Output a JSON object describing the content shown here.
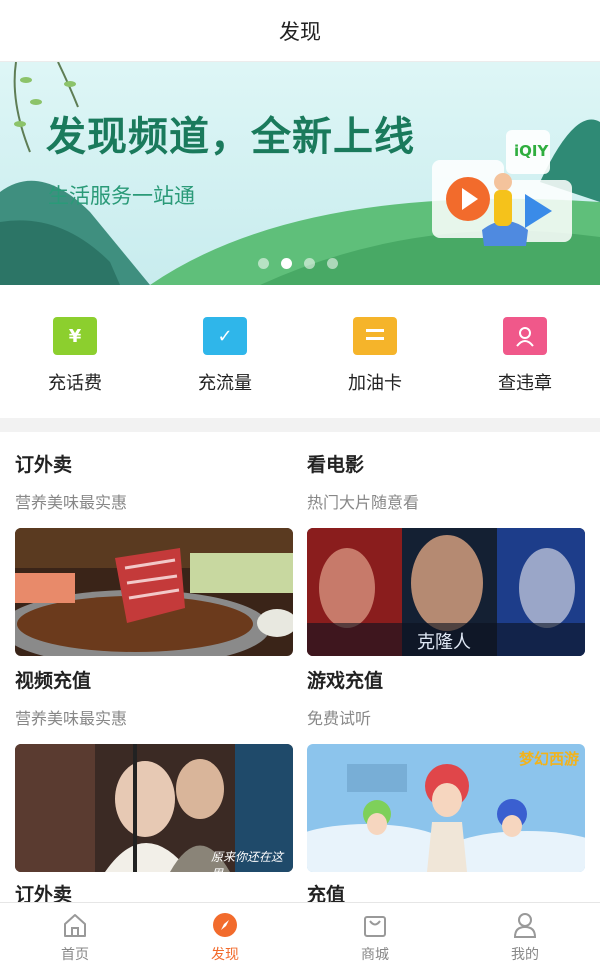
{
  "header": {
    "title": "发现"
  },
  "banner": {
    "title": "发现频道，全新上线",
    "subtitle": "生活服务一站通",
    "logo_text": "iQIY",
    "dots": 4,
    "active_dot": 1
  },
  "services": [
    {
      "label": "充话费",
      "icon": "yuan-card-icon",
      "symbol": "¥",
      "color": "#8ccf2e"
    },
    {
      "label": "充流量",
      "icon": "calendar-check-icon",
      "symbol": "✓",
      "color": "#2fb6ea"
    },
    {
      "label": "加油卡",
      "icon": "fuel-card-icon",
      "symbol": "",
      "color": "#f5b42a"
    },
    {
      "label": "查违章",
      "icon": "person-card-icon",
      "symbol": "",
      "color": "#f0588a"
    }
  ],
  "cards": [
    {
      "title": "订外卖",
      "subtitle": "营养美味最实惠"
    },
    {
      "title": "看电影",
      "subtitle": "热门大片随意看",
      "image_text": "克隆人"
    },
    {
      "title": "视频充值",
      "subtitle": "营养美味最实惠",
      "image_text": "原来你还在这里"
    },
    {
      "title": "游戏充值",
      "subtitle": "免费试听",
      "image_text": "梦幻西游"
    },
    {
      "title": "订外卖"
    },
    {
      "title": "充值"
    }
  ],
  "tabs": [
    {
      "label": "首页",
      "icon": "home-icon"
    },
    {
      "label": "发现",
      "icon": "compass-icon",
      "active": true
    },
    {
      "label": "商城",
      "icon": "shopping-bag-icon"
    },
    {
      "label": "我的",
      "icon": "user-icon"
    }
  ],
  "colors": {
    "accent": "#f26b2c",
    "banner_green": "#1a7a5c"
  }
}
